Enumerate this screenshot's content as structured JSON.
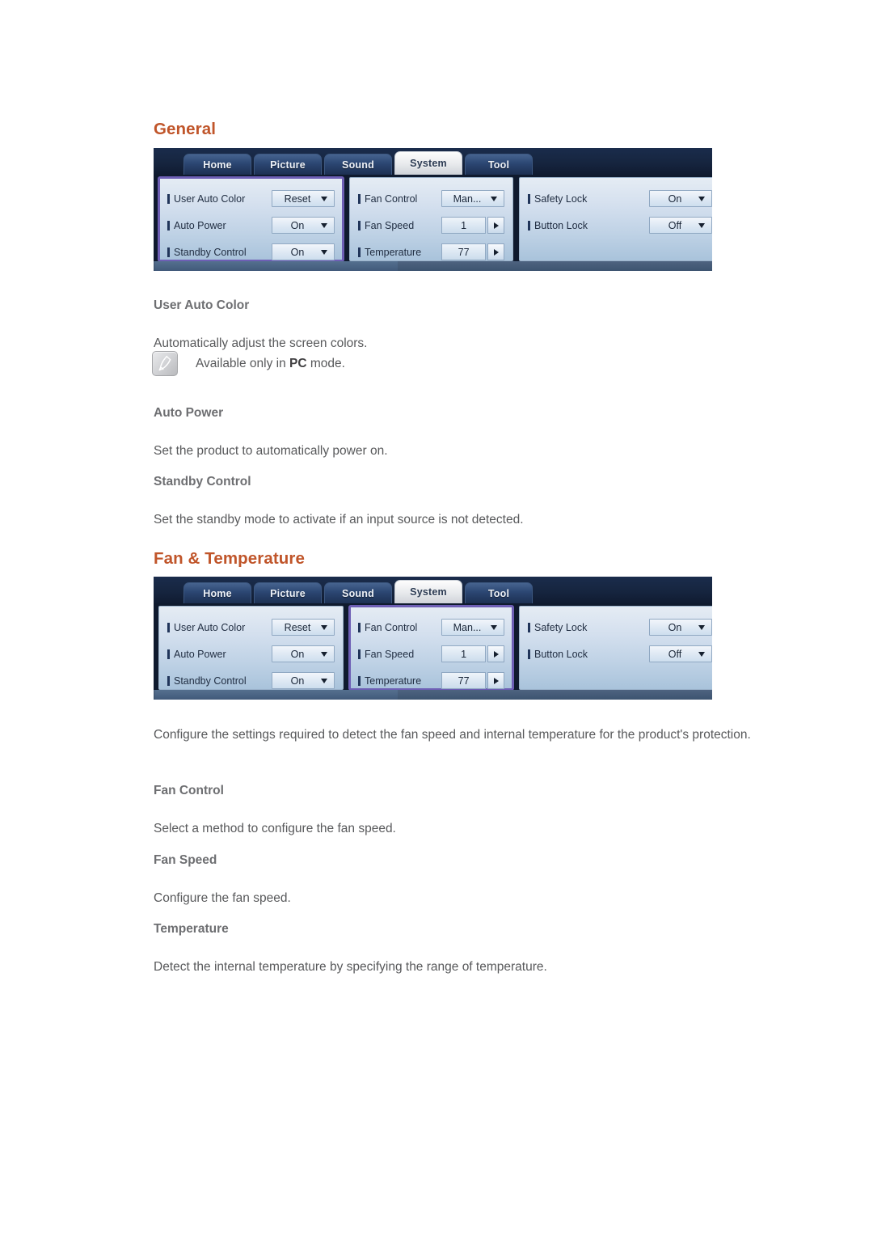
{
  "sections": [
    {
      "heading": "General",
      "osd": {
        "tabs": [
          {
            "label": "Home",
            "active": false
          },
          {
            "label": "Picture",
            "active": false
          },
          {
            "label": "Sound",
            "active": false
          },
          {
            "label": "System",
            "active": true
          },
          {
            "label": "Tool",
            "active": false
          }
        ],
        "highlight_column": 0,
        "columns": [
          {
            "rows": [
              {
                "label": "User Auto Color",
                "value": "Reset",
                "control": "select"
              },
              {
                "label": "Auto Power",
                "value": "On",
                "control": "select"
              },
              {
                "label": "Standby Control",
                "value": "On",
                "control": "select"
              }
            ]
          },
          {
            "rows": [
              {
                "label": "Fan Control",
                "value": "Man...",
                "control": "select"
              },
              {
                "label": "Fan Speed",
                "value": "1",
                "control": "stepper"
              },
              {
                "label": "Temperature",
                "value": "77",
                "control": "stepper"
              }
            ]
          },
          {
            "rows": [
              {
                "label": "Safety Lock",
                "value": "On",
                "control": "select"
              },
              {
                "label": "Button Lock",
                "value": "Off",
                "control": "select"
              }
            ]
          }
        ]
      },
      "items": [
        {
          "title": "User Auto Color",
          "body": "Automatically adjust the screen colors."
        },
        {
          "title": "Auto Power",
          "body": "Set the product to automatically power on."
        },
        {
          "title": "Standby Control",
          "body": "Set the standby mode to activate if an input source is not detected."
        }
      ],
      "note": {
        "icon": "note-pencil-icon",
        "prefix": "Available only in ",
        "emphasis": "PC",
        "suffix": " mode."
      }
    },
    {
      "heading": "Fan & Temperature",
      "osd": {
        "tabs": [
          {
            "label": "Home",
            "active": false
          },
          {
            "label": "Picture",
            "active": false
          },
          {
            "label": "Sound",
            "active": false
          },
          {
            "label": "System",
            "active": true
          },
          {
            "label": "Tool",
            "active": false
          }
        ],
        "highlight_column": 1,
        "columns": [
          {
            "rows": [
              {
                "label": "User Auto Color",
                "value": "Reset",
                "control": "select"
              },
              {
                "label": "Auto Power",
                "value": "On",
                "control": "select"
              },
              {
                "label": "Standby Control",
                "value": "On",
                "control": "select"
              }
            ]
          },
          {
            "rows": [
              {
                "label": "Fan Control",
                "value": "Man...",
                "control": "select"
              },
              {
                "label": "Fan Speed",
                "value": "1",
                "control": "stepper"
              },
              {
                "label": "Temperature",
                "value": "77",
                "control": "stepper"
              }
            ]
          },
          {
            "rows": [
              {
                "label": "Safety Lock",
                "value": "On",
                "control": "select"
              },
              {
                "label": "Button Lock",
                "value": "Off",
                "control": "select"
              }
            ]
          }
        ]
      },
      "intro": "Configure the settings required to detect the fan speed and internal temperature for the product's protection.",
      "items": [
        {
          "title": "Fan Control",
          "body": "Select a method to configure the fan speed."
        },
        {
          "title": "Fan Speed",
          "body": "Configure the fan speed."
        },
        {
          "title": "Temperature",
          "body": "Detect the internal temperature by specifying the range of temperature."
        }
      ]
    }
  ],
  "colors": {
    "heading": "#c0552a",
    "body_text": "#58595b",
    "sub_heading": "#6d6e71",
    "highlight_outline": "#6e5fb5",
    "osd_dark": "#132039"
  }
}
